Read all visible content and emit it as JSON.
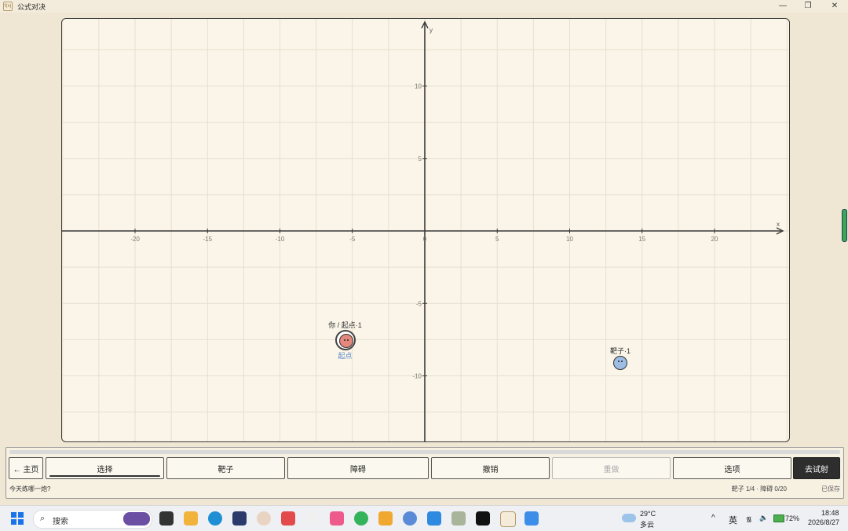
{
  "window": {
    "title": "公式对决",
    "app_icon_text": "f(x)",
    "minimize": "—",
    "restore": "❐",
    "close": "✕"
  },
  "graph": {
    "x_axis_label": "x",
    "y_axis_label": "y",
    "x_ticks": [
      "-20",
      "-15",
      "-10",
      "-5",
      "0",
      "5",
      "10",
      "15",
      "20"
    ],
    "y_ticks": [
      "10",
      "5",
      "-5",
      "-10"
    ],
    "start_marker": {
      "label": "你 / 起点·1",
      "sublabel": "起点",
      "x": -5.5,
      "y": -7.5
    },
    "target_marker": {
      "label": "靶子·1",
      "x": 13.5,
      "y": -9
    }
  },
  "toolbar": {
    "home": "← 主页",
    "select": "选择",
    "target": "靶子",
    "obstacle": "障碍",
    "undo": "撤销",
    "redo": "重做",
    "options": "选项",
    "fire": "去试射",
    "hint": "今天练哪一炮?",
    "status": "靶子 1/4 · 障碍 0/20",
    "saved": "已保存"
  },
  "taskbar": {
    "search_placeholder": "搜索",
    "weather_temp": "29°C",
    "weather_desc": "多云",
    "ime": "英",
    "battery": "72%",
    "time": "18:48",
    "date": "2026/8/27",
    "chevron": "^"
  },
  "colors": {
    "board_bg": "#faf5e8",
    "start_face": "#e4877c",
    "target_face": "#9ebde3",
    "fire_button": "#2e2e2e"
  }
}
